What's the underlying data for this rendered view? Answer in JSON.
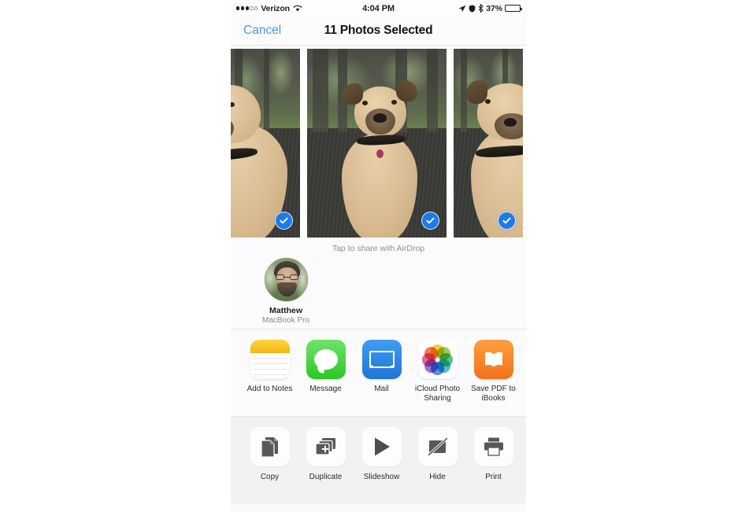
{
  "status_bar": {
    "signal_dots_filled": 3,
    "signal_dots_empty": 2,
    "carrier": "Verizon",
    "wifi_icon": "wifi-icon",
    "time": "4:04 PM",
    "location_icon": "location-arrow-icon",
    "alarm_icon": "alarm-icon",
    "bluetooth_icon": "bluetooth-icon",
    "battery_percent": "37%",
    "battery_level": 37
  },
  "nav": {
    "cancel_label": "Cancel",
    "title": "11 Photos Selected"
  },
  "photos": {
    "items": [
      {
        "alt": "Tan dog sitting in grass, partial left crop",
        "selected": true,
        "check_icon": "check-circle-icon"
      },
      {
        "alt": "Tan dog sitting in grass, centered",
        "selected": true,
        "check_icon": "check-circle-icon"
      },
      {
        "alt": "Tan dog sitting in grass, partial right crop",
        "selected": true,
        "check_icon": "check-circle-icon"
      }
    ]
  },
  "airdrop": {
    "hint": "Tap to share with AirDrop",
    "target": {
      "name": "Matthew",
      "device": "MacBook Pro",
      "avatar_icon": "contact-avatar"
    }
  },
  "apps": {
    "items": [
      {
        "label": "Add to Notes",
        "icon": "notes-icon"
      },
      {
        "label": "Message",
        "icon": "messages-icon"
      },
      {
        "label": "Mail",
        "icon": "mail-icon"
      },
      {
        "label": "iCloud Photo Sharing",
        "icon": "photos-icon"
      },
      {
        "label": "Save PDF to iBooks",
        "icon": "ibooks-icon"
      }
    ]
  },
  "actions": {
    "items": [
      {
        "label": "Copy",
        "icon": "copy-icon"
      },
      {
        "label": "Duplicate",
        "icon": "duplicate-icon"
      },
      {
        "label": "Slideshow",
        "icon": "play-icon"
      },
      {
        "label": "Hide",
        "icon": "hide-icon"
      },
      {
        "label": "Print",
        "icon": "printer-icon"
      }
    ]
  },
  "colors": {
    "accent_blue": "#4f96e8",
    "selection_blue": "#1e7ae8",
    "notes_yellow": "#f3b816",
    "messages_green": "#2bc723",
    "mail_blue": "#1f74d8",
    "ibooks_orange": "#f2711c",
    "sheet_background": "#fbfafc",
    "action_background": "#f2f1f3"
  }
}
